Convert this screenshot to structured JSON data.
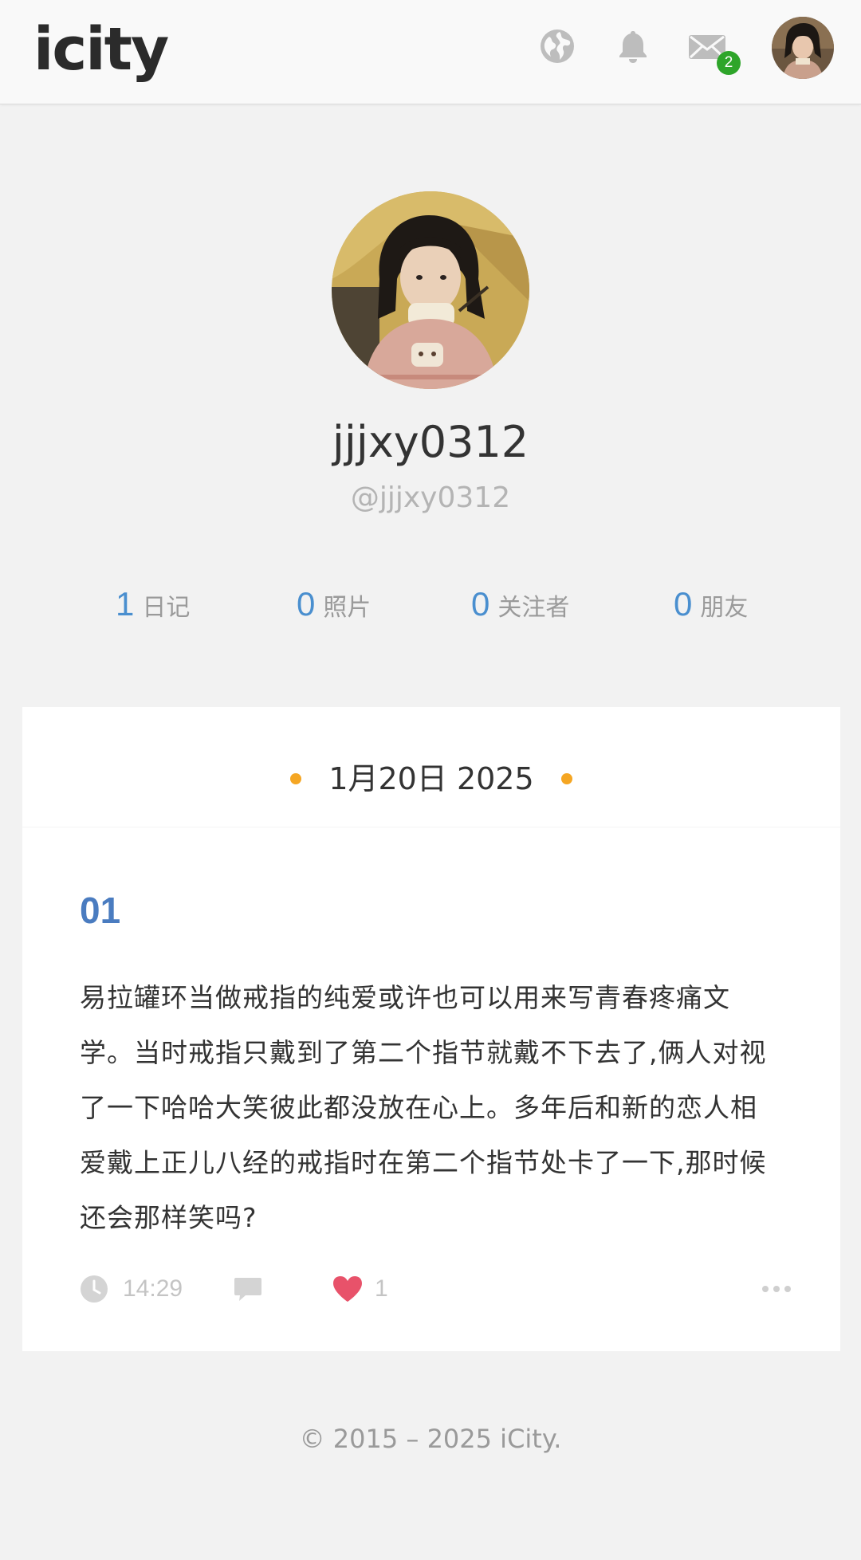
{
  "header": {
    "logo": "icity",
    "icons": [
      "globe-icon",
      "bell-icon",
      "mail-icon"
    ],
    "mail_badge": "2",
    "avatar": "user-avatar"
  },
  "profile": {
    "name": "jjjxy0312",
    "handle": "@jjjxy0312"
  },
  "stats": [
    {
      "value": "1",
      "label": "日记"
    },
    {
      "value": "0",
      "label": "照片"
    },
    {
      "value": "0",
      "label": "关注者"
    },
    {
      "value": "0",
      "label": "朋友"
    }
  ],
  "entry": {
    "date": "1月20日 2025",
    "title": "01",
    "body": "易拉罐环当做戒指的纯爱或许也可以用来写青春疼痛文学。当时戒指只戴到了第二个指节就戴不下去了,俩人对视了一下哈哈大笑彼此都没放在心上。多年后和新的恋人相爱戴上正儿八经的戒指时在第二个指节处卡了一下,那时候还会那样笑吗?",
    "time": "14:29",
    "likes": "1",
    "icons": [
      "clock-icon",
      "comment-icon",
      "heart-icon",
      "more-icon"
    ]
  },
  "footer": {
    "text": "© 2015 – 2025 iCity."
  },
  "colors": {
    "accent_blue": "#4a8fcf",
    "title_blue": "#4a7cc0",
    "badge_green": "#2ea52a",
    "dot_orange": "#f5a623",
    "heart_red": "#e8526a"
  }
}
